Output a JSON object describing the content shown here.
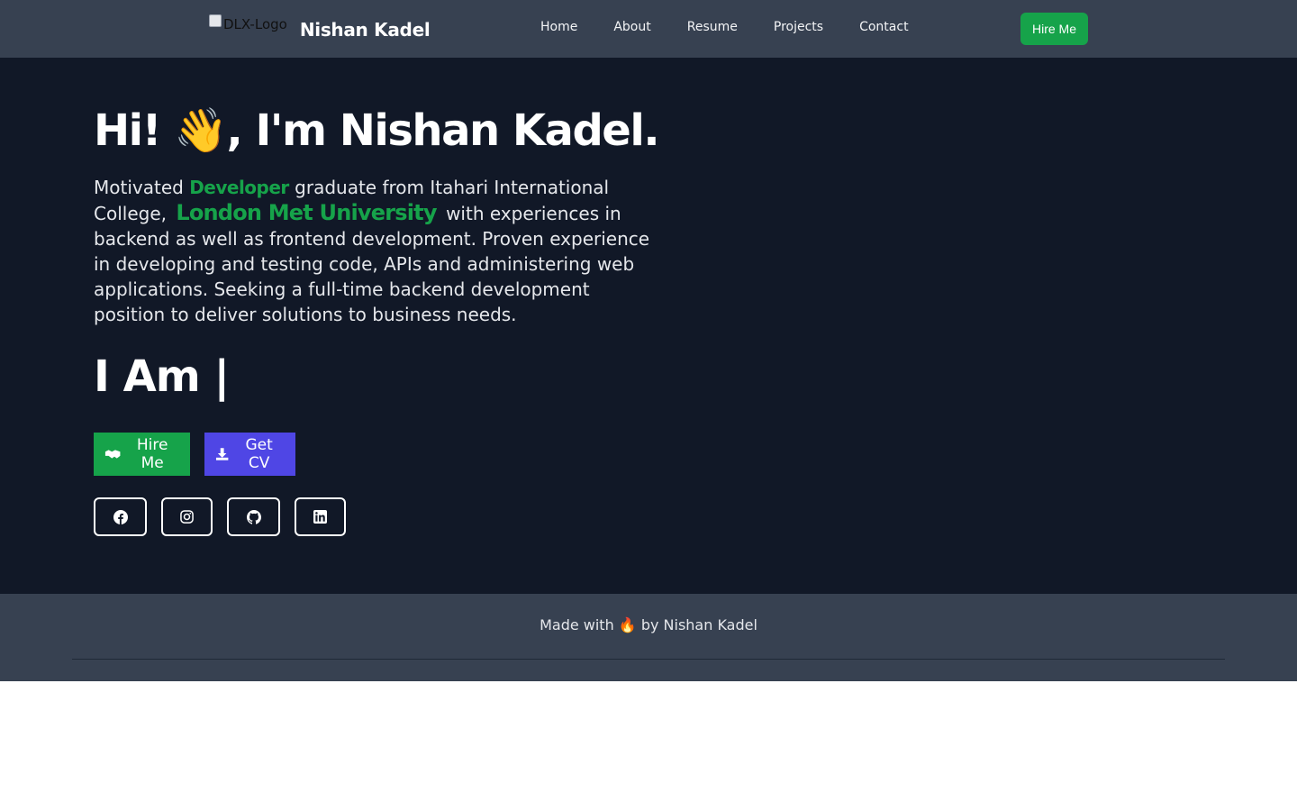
{
  "nav": {
    "logo_alt": "DLX-Logo",
    "brand": "Nishan Kadel",
    "links": [
      "Home",
      "About",
      "Resume",
      "Projects",
      "Contact"
    ],
    "hire_button": "Hire Me"
  },
  "hero": {
    "greeting": "Hi! 👋, I'm Nishan Kadel.",
    "bio_prefix": "Motivated",
    "bio_highlight_role": "Developer",
    "bio_middle": "graduate from Itahari International College,",
    "bio_highlight_university": "London Met University",
    "bio_suffix": "with experiences in backend as well as frontend development. Proven experience in developing and testing code, APIs and administering web applications. Seeking a full-time backend development position to deliver solutions to business needs.",
    "typewriter": "I Am |",
    "hire_button": "Hire Me",
    "cv_button": "Get CV",
    "social_icons": [
      "facebook-icon",
      "instagram-icon",
      "github-icon",
      "linkedin-icon"
    ]
  },
  "footer": {
    "text": "Made with 🔥 by Nishan Kadel"
  },
  "colors": {
    "nav_bg": "#374151",
    "hero_bg": "#111827",
    "accent_green": "#16a34a",
    "accent_indigo": "#4f46e5"
  }
}
